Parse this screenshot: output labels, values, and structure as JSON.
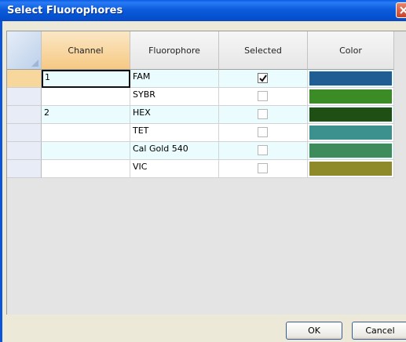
{
  "window": {
    "title": "Select Fluorophores"
  },
  "grid": {
    "columns": [
      "Channel",
      "Fluorophore",
      "Selected",
      "Color"
    ],
    "rows": [
      {
        "channel": "1",
        "fluorophore": "FAM",
        "selected": true,
        "color": "#1f5d92"
      },
      {
        "channel": "",
        "fluorophore": "SYBR",
        "selected": false,
        "color": "#3b8b26"
      },
      {
        "channel": "2",
        "fluorophore": "HEX",
        "selected": false,
        "color": "#1f4f12"
      },
      {
        "channel": "",
        "fluorophore": "TET",
        "selected": false,
        "color": "#3c908d"
      },
      {
        "channel": "",
        "fluorophore": "Cal Gold 540",
        "selected": false,
        "color": "#3e8b5c"
      },
      {
        "channel": "",
        "fluorophore": "VIC",
        "selected": false,
        "color": "#8e8a2a"
      }
    ]
  },
  "buttons": {
    "ok": "OK",
    "cancel": "Cancel"
  },
  "colors": {
    "title_bar": "#0b5bdc",
    "row_highlight": "#eafcfd",
    "active_header": "#f6c983"
  }
}
